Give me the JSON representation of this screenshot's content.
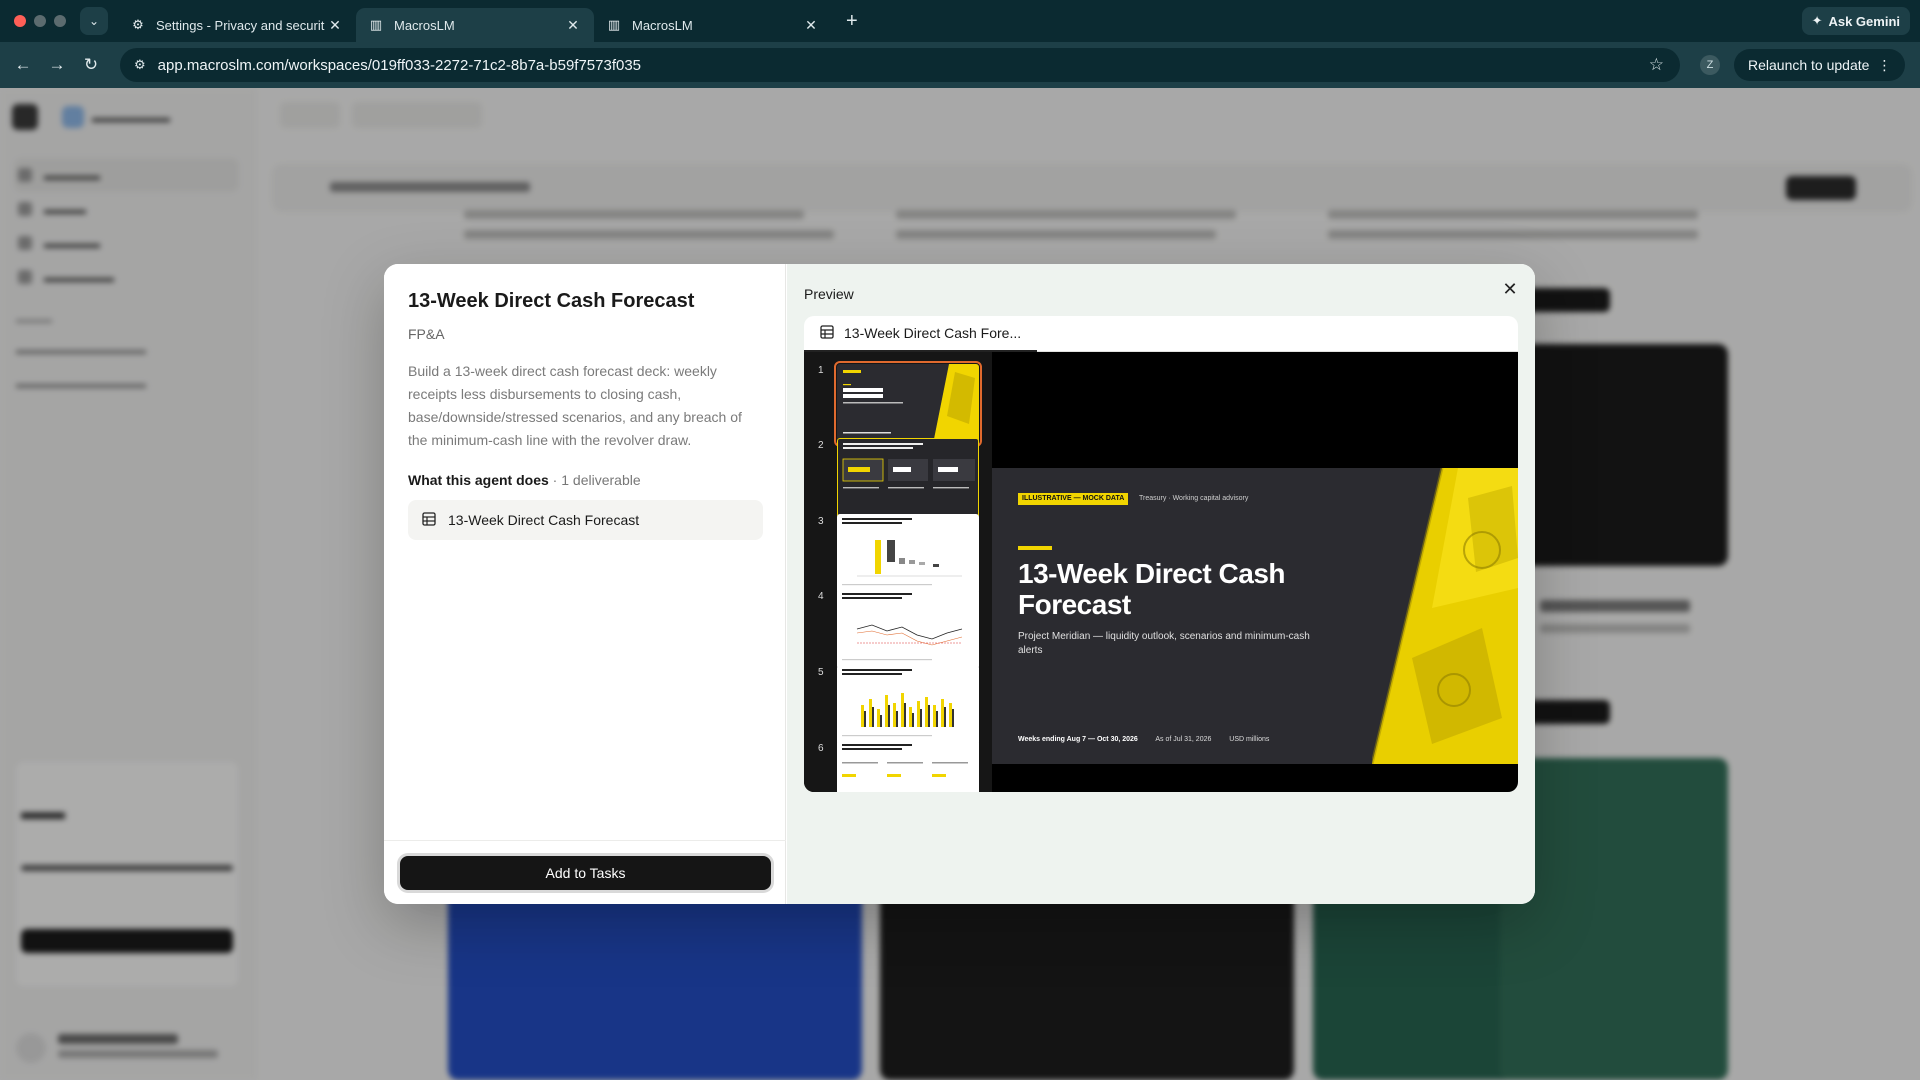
{
  "browser": {
    "tabs": [
      {
        "title": "Settings - Privacy and securit",
        "icon": "gear-icon"
      },
      {
        "title": "MacrosLM",
        "icon": "macroslm-logo-icon"
      },
      {
        "title": "MacrosLM",
        "icon": "macroslm-logo-icon"
      }
    ],
    "ask_gemini": "Ask Gemini",
    "url": "app.macroslm.com/workspaces/019ff033-2272-71c2-8b7a-b59f7573f035",
    "profile_initial": "Z",
    "relaunch": "Relaunch to update"
  },
  "modal": {
    "title": "13-Week Direct Cash Forecast",
    "category": "FP&A",
    "description": "Build a 13-week direct cash forecast deck: weekly receipts less disbursements to closing cash, base/downside/stressed scenarios, and any breach of the minimum-cash line with the revolver draw.",
    "does_label": "What this agent does",
    "deliverable_count": " · 1 deliverable",
    "deliverable": "13-Week Direct Cash Forecast",
    "add_button": "Add to Tasks",
    "preview_label": "Preview",
    "file_tab": "13-Week Direct Cash Fore..."
  },
  "slide": {
    "badge": "ILLUSTRATIVE — MOCK DATA",
    "kicker": "Treasury · Working capital advisory",
    "title": "13-Week Direct Cash Forecast",
    "subtitle": "Project Meridian — liquidity outlook, scenarios and minimum-cash alerts",
    "meta_weeks": "Weeks ending Aug 7 — Oct 30, 2026",
    "meta_asof": "As of Jul 31, 2026",
    "meta_units": "USD millions"
  },
  "thumbnails": [
    "1",
    "2",
    "3",
    "4",
    "5",
    "6"
  ],
  "colors": {
    "accent_yellow": "#f1d500",
    "slide_bg": "#2b2b30",
    "selection": "#e06a2e"
  }
}
